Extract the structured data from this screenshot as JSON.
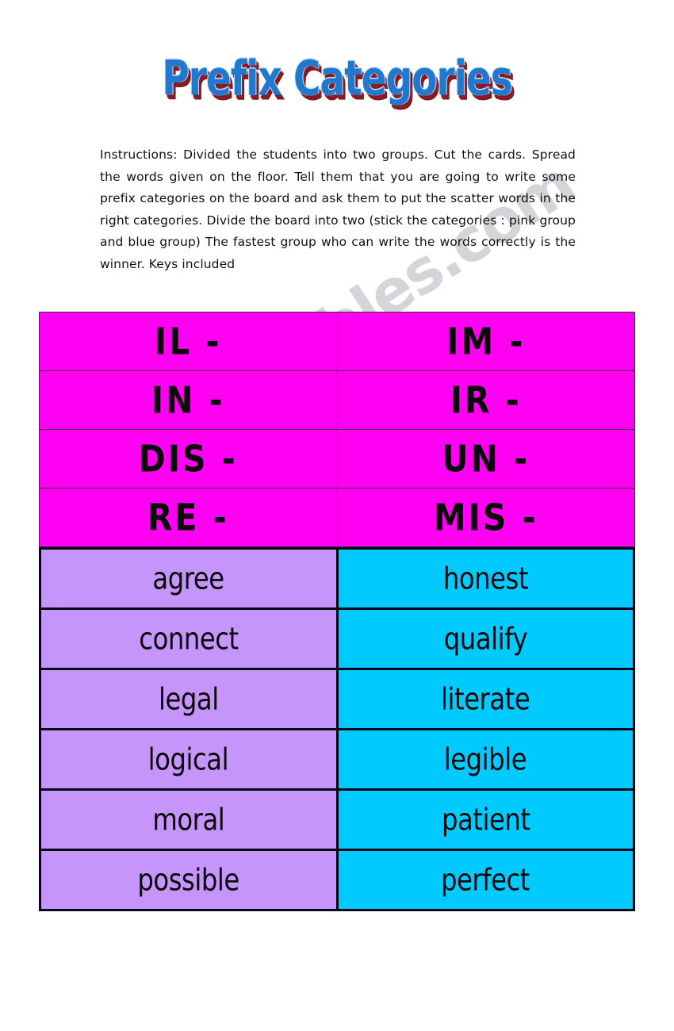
{
  "document": {
    "title": "Prefix Categories",
    "watermark": "ESLprintables.com",
    "instructions": "Instructions: Divided the students into two groups.  Cut the cards. Spread the words given on the floor.  Tell them that you are going to write some prefix categories on the board and ask them to put the scatter words in the right categories.  Divide the board into two (stick the categories : pink group and blue group) The fastest group who can write the words correctly is the winner.  Keys included"
  },
  "colors": {
    "title_fill": "#2079cf",
    "title_shadow": "#8b1b22",
    "prefix_cell": "#ff00f2",
    "word_cell_left": "#c695fb",
    "word_cell_right": "#00caff",
    "border": "#060616"
  },
  "prefix_table": {
    "rows": [
      {
        "left": "IL -",
        "right": "IM -"
      },
      {
        "left": "IN -",
        "right": "IR -"
      },
      {
        "left": "DIS -",
        "right": "UN -"
      },
      {
        "left": "RE -",
        "right": "MIS -"
      }
    ]
  },
  "words_table": {
    "rows": [
      {
        "left": "agree",
        "right": "honest"
      },
      {
        "left": "connect",
        "right": "qualify"
      },
      {
        "left": "legal",
        "right": "literate"
      },
      {
        "left": "logical",
        "right": "legible"
      },
      {
        "left": "moral",
        "right": "patient"
      },
      {
        "left": "possible",
        "right": "perfect"
      }
    ]
  }
}
